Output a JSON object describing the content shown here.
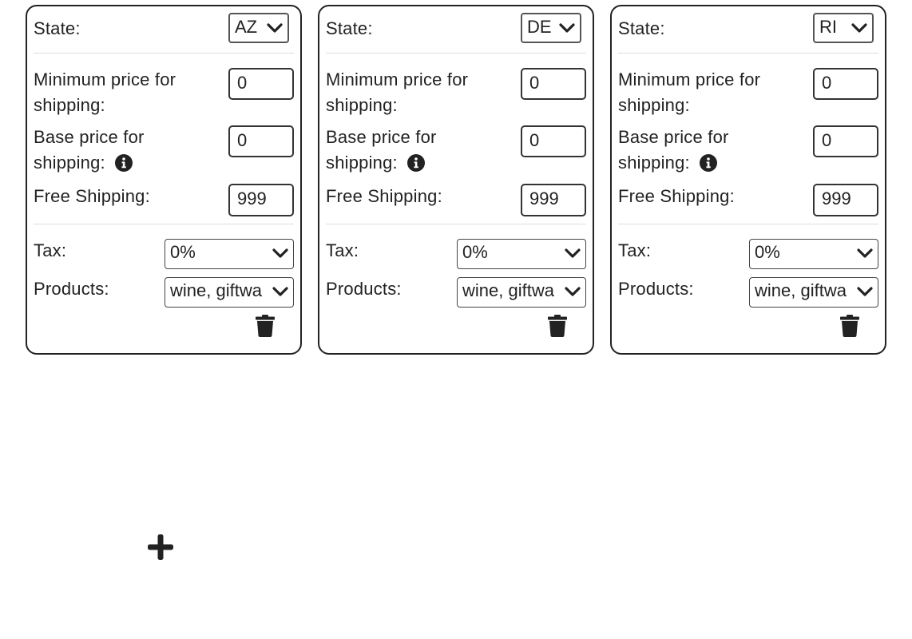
{
  "labels": {
    "state": "State:",
    "min_price": "Minimum price for shipping:",
    "base_price": "Base price for shipping:",
    "free_shipping": "Free Shipping:",
    "tax": "Tax:",
    "products": "Products:"
  },
  "cards": [
    {
      "state": "AZ",
      "min_price": "0",
      "base_price": "0",
      "free_shipping": "999",
      "tax": "0%",
      "products": "wine, giftwa"
    },
    {
      "state": "DE",
      "min_price": "0",
      "base_price": "0",
      "free_shipping": "999",
      "tax": "0%",
      "products": "wine, giftwa"
    },
    {
      "state": "RI",
      "min_price": "0",
      "base_price": "0",
      "free_shipping": "999",
      "tax": "0%",
      "products": "wine, giftwa"
    }
  ],
  "icons": {
    "info": "info-circle-icon",
    "delete": "trash-icon",
    "chevron": "chevron-down-icon",
    "add": "plus-icon"
  },
  "colors": {
    "border": "#222222",
    "separator": "#dcdcdc",
    "text": "#222222"
  }
}
